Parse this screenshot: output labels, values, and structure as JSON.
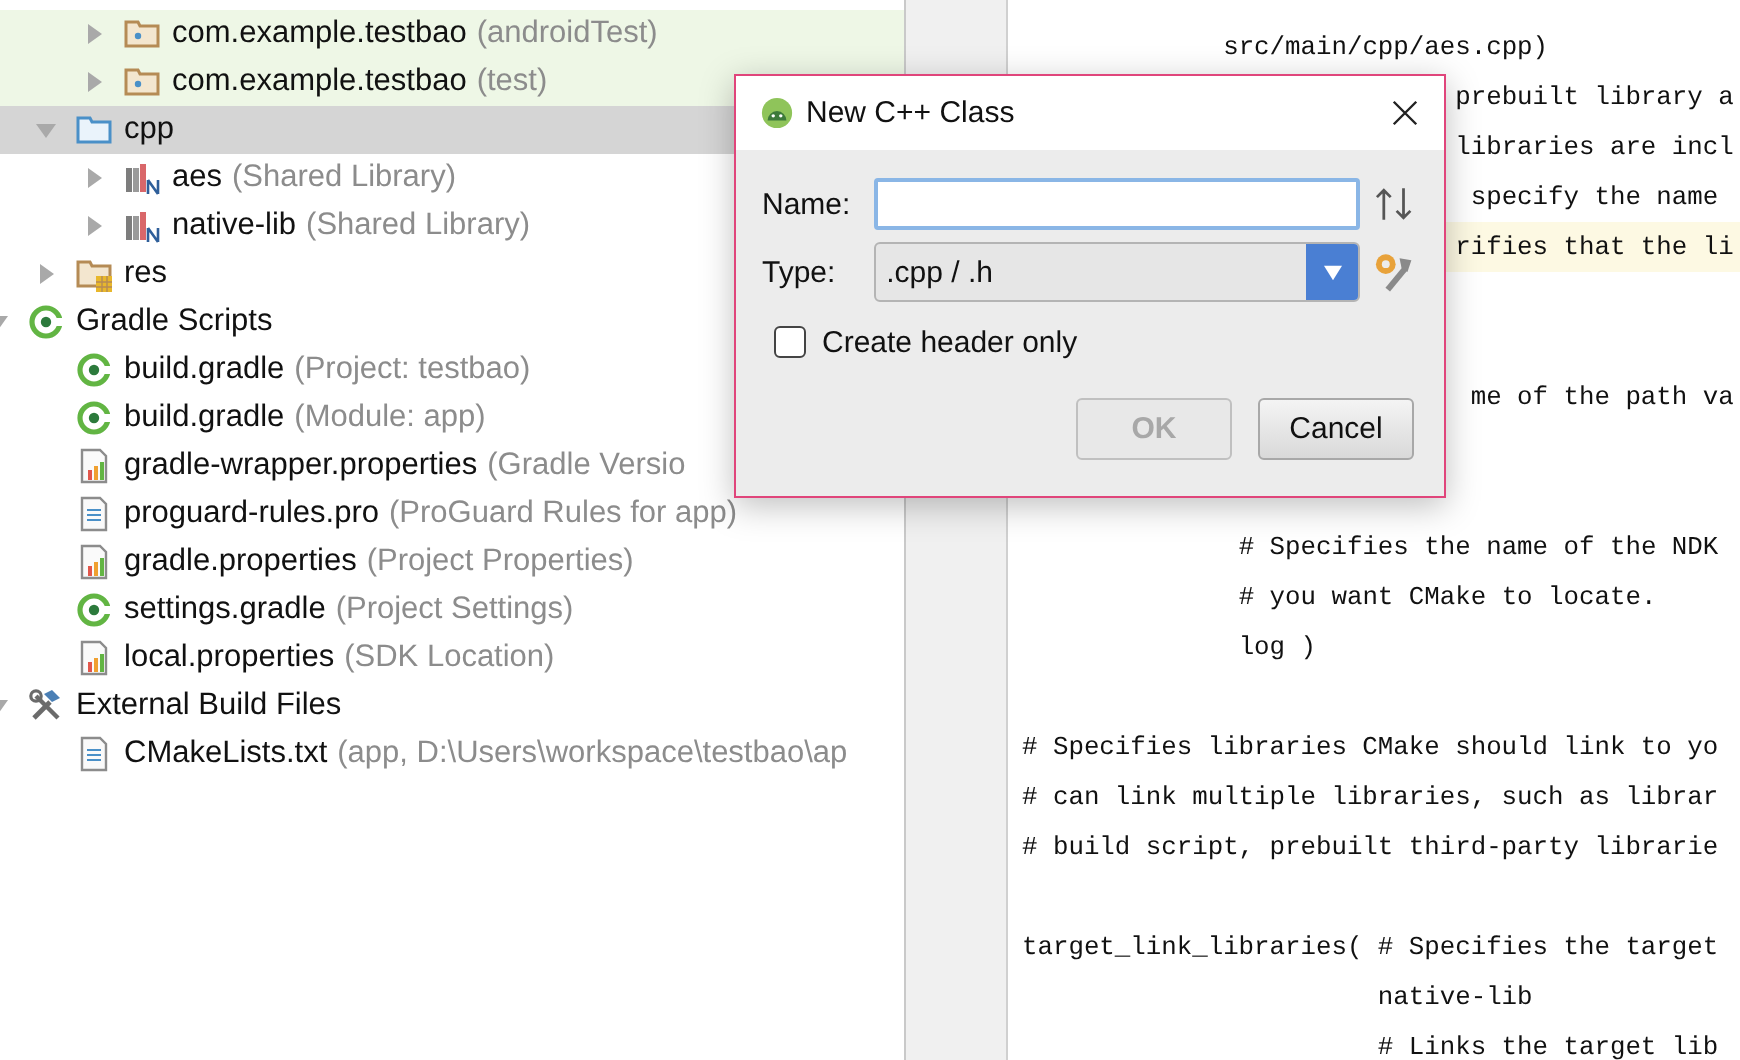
{
  "tree": {
    "items": [
      {
        "children": [
          {
            "children": [
              {
                "label": "com.example.testbao",
                "detail": "(androidTest)",
                "kind": "package",
                "expanded": false,
                "selected": false,
                "test_scope": true
              },
              {
                "label": "com.example.testbao",
                "detail": "(test)",
                "kind": "package",
                "expanded": false,
                "selected": false,
                "test_scope": true
              }
            ]
          },
          {
            "label": "cpp",
            "kind": "folder",
            "expanded": true,
            "selected": true,
            "test_scope": false,
            "children": [
              {
                "label": "aes",
                "detail": "(Shared Library)",
                "kind": "library",
                "expanded": false,
                "selected": false,
                "test_scope": false
              },
              {
                "label": "native-lib",
                "detail": "(Shared Library)",
                "kind": "library",
                "expanded": false,
                "selected": false,
                "test_scope": false
              }
            ]
          },
          {
            "label": "res",
            "kind": "res",
            "expanded": false,
            "selected": false,
            "test_scope": false
          }
        ]
      },
      {
        "label": "Gradle Scripts",
        "kind": "gradle",
        "expanded": true,
        "selected": false,
        "test_scope": false,
        "children": [
          {
            "label": "build.gradle",
            "detail": "(Project: testbao)",
            "kind": "gradle",
            "selected": false,
            "test_scope": false
          },
          {
            "label": "build.gradle",
            "detail": "(Module: app)",
            "kind": "gradle",
            "selected": false,
            "test_scope": false
          },
          {
            "label": "gradle-wrapper.properties",
            "detail": "(Gradle Versio",
            "kind": "properties",
            "selected": false,
            "test_scope": false
          },
          {
            "label": "proguard-rules.pro",
            "detail": "(ProGuard Rules for app)",
            "kind": "text",
            "selected": false,
            "test_scope": false
          },
          {
            "label": "gradle.properties",
            "detail": "(Project Properties)",
            "kind": "properties",
            "selected": false,
            "test_scope": false
          },
          {
            "label": "settings.gradle",
            "detail": "(Project Settings)",
            "kind": "gradle",
            "selected": false,
            "test_scope": false
          },
          {
            "label": "local.properties",
            "detail": "(SDK Location)",
            "kind": "properties",
            "selected": false,
            "test_scope": false
          }
        ]
      },
      {
        "label": "External Build Files",
        "kind": "tools",
        "expanded": true,
        "selected": false,
        "test_scope": false,
        "children": [
          {
            "label": "CMakeLists.txt",
            "detail": "(app, D:\\Users\\workspace\\testbao\\ap",
            "kind": "text",
            "selected": false,
            "test_scope": false
          }
        ]
      }
    ]
  },
  "editor": {
    "lines": [
      {
        "text": "             src/main/cpp/aes.cpp)",
        "current": false
      },
      {
        "text": "                            prebuilt library a",
        "current": false
      },
      {
        "text": "                            libraries are incl",
        "current": false
      },
      {
        "text": "                             specify the name",
        "current": false
      },
      {
        "text": "                            rifies that the li",
        "current": true
      },
      {
        "current": false
      },
      {
        "current": false
      },
      {
        "text": "                             me of the path va",
        "current": false
      },
      {
        "current": false
      },
      {
        "current": false
      },
      {
        "text": "              # Specifies the name of the NDK",
        "current": false
      },
      {
        "text": "              # you want CMake to locate.",
        "current": false
      },
      {
        "text": "              log )",
        "current": false
      },
      {
        "current": false
      },
      {
        "text": "# Specifies libraries CMake should link to yo",
        "current": false
      },
      {
        "text": "# can link multiple libraries, such as librar",
        "current": false
      },
      {
        "text": "# build script, prebuilt third-party librarie",
        "current": false
      },
      {
        "current": false
      },
      {
        "text": "target_link_libraries( # Specifies the target",
        "current": false
      },
      {
        "text": "                       native-lib",
        "current": false
      },
      {
        "text": "                       # Links the target lib",
        "current": false
      }
    ]
  },
  "dialog": {
    "title": "New C++ Class",
    "name_field": {
      "label": "Name:"
    },
    "type_field": {
      "label": "Type:",
      "value": ".cpp / .h"
    },
    "header_only": {
      "label": "Create header only",
      "checked": false
    },
    "buttons": [
      {
        "label": "OK",
        "disabled": true
      },
      {
        "label": "Cancel",
        "disabled": false
      }
    ]
  }
}
